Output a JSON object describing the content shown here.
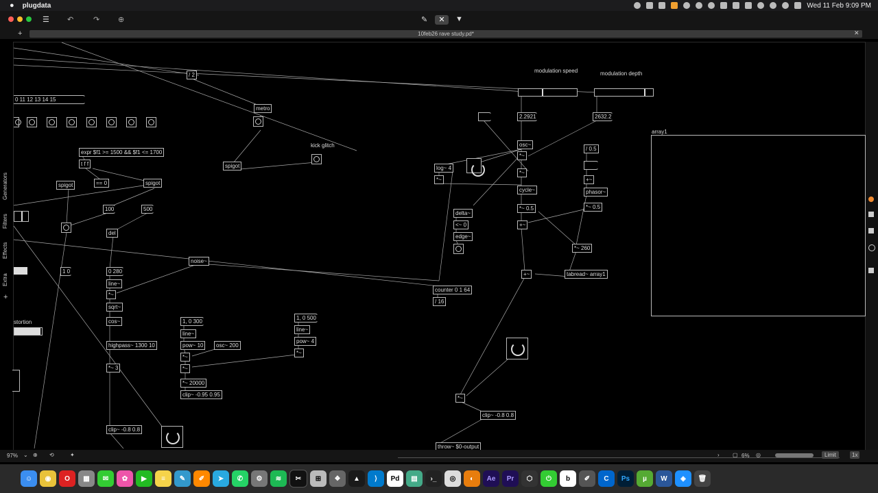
{
  "menubar": {
    "apple": "",
    "app": "plugdata",
    "datetime": "Wed 11 Feb  9:09 PM"
  },
  "window": {
    "tab_title": "10feb26 rave study.pd*"
  },
  "sidebar": {
    "items": [
      "Generators",
      "Filters",
      "Effects",
      "Extra"
    ],
    "add": "+"
  },
  "patch": {
    "comments": {
      "mod_speed": "modulation speed",
      "mod_depth": "modulation depth",
      "kick_glitch": "kick glitch",
      "array_name": "array1",
      "distortion": "stortion"
    },
    "objects": {
      "div2": "/ 2",
      "metro": "metro",
      "msg_seq": "0 11 12 13 14 15",
      "expr": "expr $f1 >= 1500 && $f1 <= 1700",
      "tff": "t f f",
      "spigot1": "spigot",
      "spigot2": "spigot",
      "spigot3": "spigot",
      "eq0": "== 0",
      "n100": "100",
      "n500": "500",
      "del": "del",
      "msg_10": "1 0",
      "msg_0280": "0 280",
      "line1": "line~",
      "mul1": "*~",
      "sqrt": "sqrt~",
      "cos": "cos~",
      "highpass": "highpass~ 1300 10",
      "mul3": "*~ 3",
      "clip1": "clip~ -0.8 0.8",
      "noise": "noise~",
      "msg_1_0_300": "1, 0 300",
      "line2": "line~",
      "pow10": "pow~ 10",
      "osc200": "osc~ 200",
      "mul2": "*~",
      "mul2b": "*~",
      "mul20000": "*~ 20000",
      "clip2": "clip~ -0.95 0.95",
      "msg_1_0_500": "1, 0 500",
      "line3": "line~",
      "pow4": "pow~ 4",
      "mul4": "*~",
      "log4": "log~ 4",
      "mul5": "*~",
      "delta": "delta~",
      "lt0": "<~ 0",
      "edge": "edge~",
      "counter": "counter 0 1 64",
      "div16": "/ 16",
      "num_speed": "2.2921",
      "num_depth": "2632.2",
      "osc": "osc~",
      "mul6": "*~",
      "mul7": "*~",
      "cycle": "cycle~",
      "mul05a": "*~ 0.5",
      "add1": "+~",
      "div05": "/ 0.5",
      "add2": "+~",
      "phasor": "phasor~",
      "mul05b": "*~ 0.5",
      "mul260": "*~ 260",
      "tabread": "tabread~ array1",
      "add3": "+~",
      "mul8": "*~",
      "clip3": "clip~ -0.8 0.8",
      "throw": "throw~ $0-output"
    },
    "sliders": {
      "speed_value": 0.4,
      "depth_value": 0.85
    }
  },
  "statusbar": {
    "zoom": "97%",
    "cpu": "6%",
    "limit": "Limit",
    "scale": "1x"
  },
  "dock": {
    "apps": [
      "Finder",
      "Chrome",
      "Opera",
      "Launchpad",
      "Messages",
      "Photos",
      "FaceTime",
      "Notes",
      "Pen",
      "Pages",
      "Telegram",
      "WhatsApp",
      "Settings",
      "Spotify",
      "Capcut",
      "Calc",
      "Resolve",
      "Inkscape",
      "VS Code",
      "Pd",
      "Photo",
      "Terminal",
      "plugdata",
      "Blender",
      "Ae",
      "Pr",
      "Unity",
      "Toggl",
      "b",
      "Edit",
      "Cursor",
      "Ps",
      "uTorrent",
      "Word",
      "Safari",
      "Trash"
    ]
  }
}
